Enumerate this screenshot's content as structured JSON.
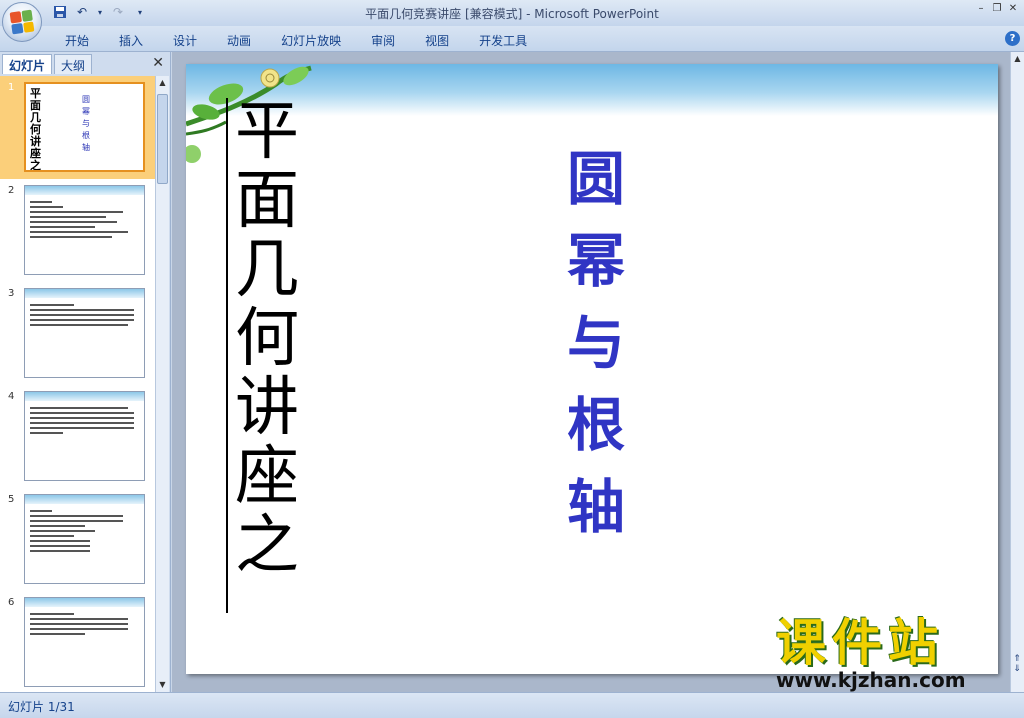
{
  "window": {
    "title": "平面几何竞赛讲座 [兼容模式] - Microsoft PowerPoint"
  },
  "ribbon": {
    "tabs": [
      "开始",
      "插入",
      "设计",
      "动画",
      "幻灯片放映",
      "审阅",
      "视图",
      "开发工具"
    ]
  },
  "left_panel": {
    "tabs": [
      "幻灯片",
      "大纲"
    ],
    "thumbnails": [
      {
        "number": "1",
        "left_title": "平面几何讲座之",
        "right_title": "圆幂与根轴"
      },
      {
        "number": "2"
      },
      {
        "number": "3"
      },
      {
        "number": "4"
      },
      {
        "number": "5"
      },
      {
        "number": "6"
      }
    ]
  },
  "slide": {
    "title": "平面几何讲座之",
    "subtitle": "圆幂与根轴"
  },
  "status_bar": {
    "slide_indicator": "幻灯片 1/31"
  },
  "watermark": {
    "brand": "课件站",
    "url": "www.kjzhan.com"
  },
  "colors": {
    "subtitle": "#3035c4",
    "selected_thumbnail": "#fbcf7a",
    "watermark": "#f0d000"
  }
}
